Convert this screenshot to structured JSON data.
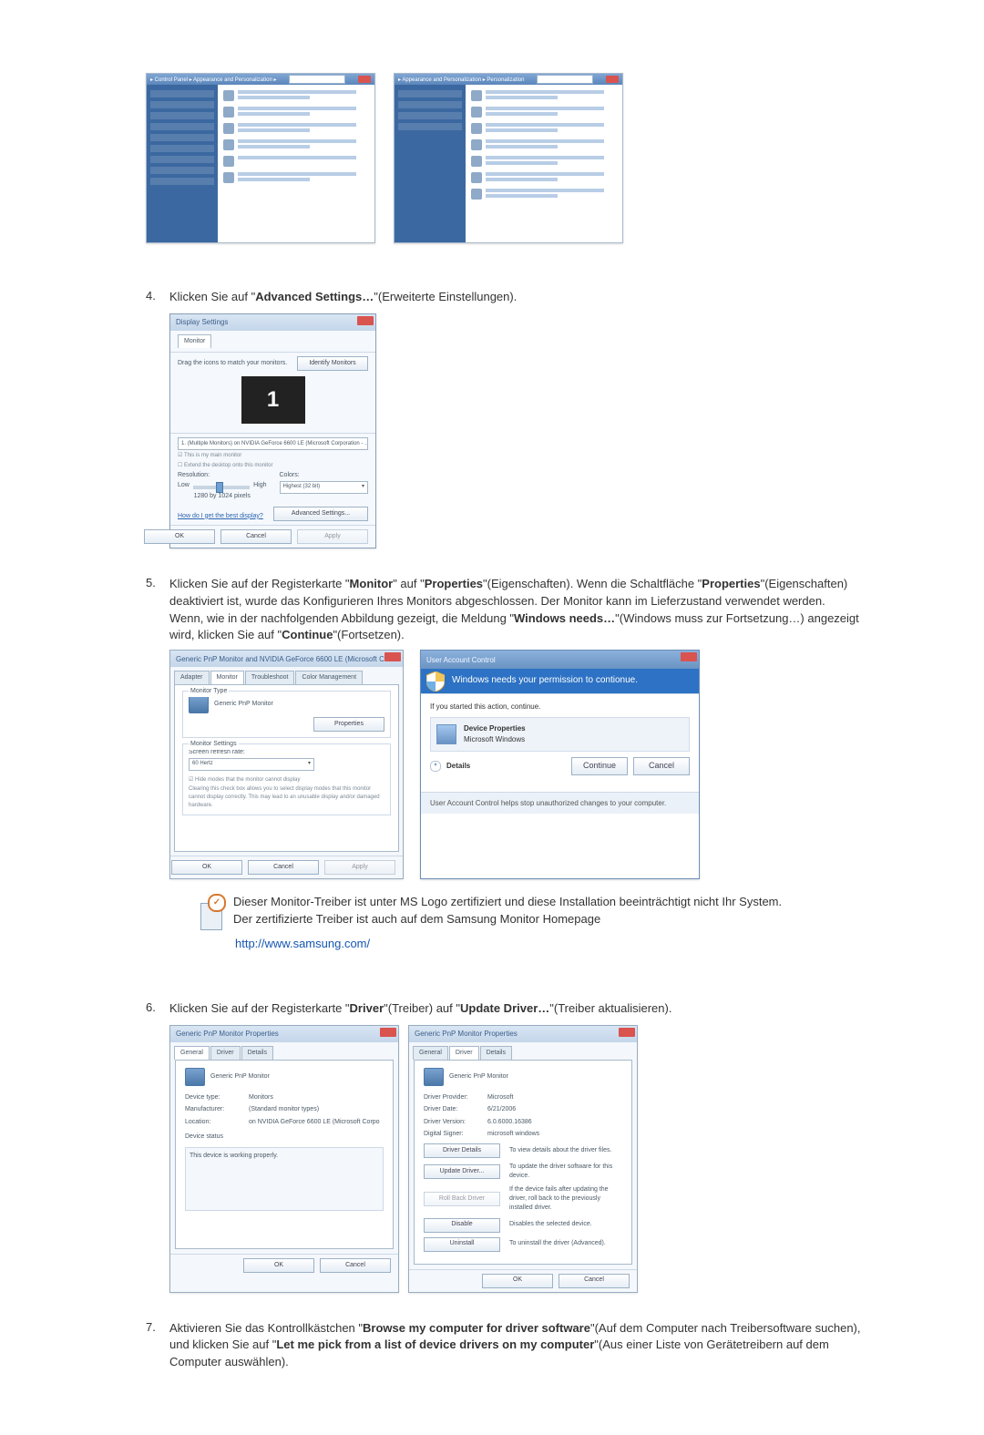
{
  "step4": {
    "num": "4.",
    "text1": "Klicken Sie auf \"",
    "bold1": "Advanced Settings…",
    "text2": "\"(Erweiterte Einstellungen).",
    "dlg": {
      "title": "Display Settings",
      "tab": "Monitor",
      "drag": "Drag the icons to match your monitors.",
      "identify": "Identify Monitors",
      "preview": "1",
      "monitorSelect": "1. (Multiple Monitors) on NVIDIA GeForce 6600 LE (Microsoft Corporation - …",
      "mainCheck": "☑ This is my main monitor",
      "extendCheck": "☐ Extend the desktop onto this monitor",
      "resLabel": "Resolution:",
      "resLow": "Low",
      "resHigh": "High",
      "resValue": "1280 by 1024 pixels",
      "colorsLabel": "Colors:",
      "colorsValue": "Highest (32 bit)",
      "helpLink": "How do I get the best display?",
      "advanced": "Advanced Settings...",
      "ok": "OK",
      "cancel": "Cancel",
      "apply": "Apply"
    }
  },
  "step5": {
    "num": "5.",
    "l1_a": "Klicken Sie auf der Registerkarte \"",
    "l1_b": "Monitor",
    "l1_c": "\" auf \"",
    "l1_d": "Properties",
    "l1_e": "\"(Eigenschaften). Wenn die Schaltfläche \"",
    "l1_f": "Properties",
    "l1_g": "\"(Eigenschaften) deaktiviert ist, wurde das Konfigurieren Ihres Monitors abgeschlossen. Der Monitor kann im Lieferzustand verwendet werden.",
    "l2_a": "Wenn, wie in der nachfolgenden Abbildung gezeigt, die Meldung \"",
    "l2_b": "Windows needs…",
    "l2_c": "\"(Windows muss zur Fortsetzung…) angezeigt wird, klicken Sie auf \"",
    "l2_d": "Continue",
    "l2_e": "\"(Fortsetzen).",
    "mon": {
      "title": "Generic PnP Monitor and NVIDIA GeForce 6600 LE (Microsoft Co...",
      "tabs": [
        "Adapter",
        "Monitor",
        "Troubleshoot",
        "Color Management"
      ],
      "typeLabel": "Monitor Type",
      "typeValue": "Generic PnP Monitor",
      "propsBtn": "Properties",
      "settingsLabel": "Monitor Settings",
      "refreshLabel": "Screen refresh rate:",
      "refreshValue": "60 Hertz",
      "hideCheck": "☑ Hide modes that the monitor cannot display",
      "hideHelp": "Clearing this check box allows you to select display modes that this monitor cannot display correctly. This may lead to an unusable display and/or damaged hardware.",
      "ok": "OK",
      "cancel": "Cancel",
      "apply": "Apply"
    },
    "uac": {
      "title": "User Account Control",
      "banner": "Windows needs your permission to contionue.",
      "started": "If you started this action, continue.",
      "itemTitle": "Device Properties",
      "itemPub": "Microsoft Windows",
      "details": "Details",
      "continue": "Continue",
      "cancel": "Cancel",
      "footer": "User Account Control helps stop unauthorized changes to your computer."
    }
  },
  "note": {
    "l1": "Dieser Monitor-Treiber ist unter MS Logo zertifiziert und diese Installation beeinträchtigt nicht Ihr System.",
    "l2": "Der zertifizierte Treiber ist auch auf dem Samsung Monitor Homepage",
    "link": "http://www.samsung.com/"
  },
  "step6": {
    "num": "6.",
    "a": "Klicken Sie auf der Registerkarte \"",
    "b": "Driver",
    "c": "\"(Treiber) auf \"",
    "d": "Update Driver…",
    "e": "\"(Treiber aktualisieren).",
    "left": {
      "title": "Generic PnP Monitor Properties",
      "tabs": [
        "General",
        "Driver",
        "Details"
      ],
      "device": "Generic PnP Monitor",
      "devType": {
        "k": "Device type:",
        "v": "Monitors"
      },
      "manu": {
        "k": "Manufacturer:",
        "v": "(Standard monitor types)"
      },
      "loc": {
        "k": "Location:",
        "v": "on NVIDIA GeForce 6600 LE (Microsoft Corpo"
      },
      "statusLabel": "Device status",
      "status": "This device is working properly.",
      "ok": "OK",
      "cancel": "Cancel"
    },
    "right": {
      "title": "Generic PnP Monitor Properties",
      "tabs": [
        "General",
        "Driver",
        "Details"
      ],
      "device": "Generic PnP Monitor",
      "provider": {
        "k": "Driver Provider:",
        "v": "Microsoft"
      },
      "date": {
        "k": "Driver Date:",
        "v": "6/21/2006"
      },
      "version": {
        "k": "Driver Version:",
        "v": "6.0.6000.16386"
      },
      "signer": {
        "k": "Digital Signer:",
        "v": "microsoft windows"
      },
      "btnDetails": "Driver Details",
      "btnDetailsDesc": "To view details about the driver files.",
      "btnUpdate": "Update Driver...",
      "btnUpdateDesc": "To update the driver software for this device.",
      "btnRoll": "Roll Back Driver",
      "btnRollDesc": "If the device fails after updating the driver, roll back to the previously installed driver.",
      "btnDisable": "Disable",
      "btnDisableDesc": "Disables the selected device.",
      "btnUninstall": "Uninstall",
      "btnUninstallDesc": "To uninstall the driver (Advanced).",
      "ok": "OK",
      "cancel": "Cancel"
    }
  },
  "step7": {
    "num": "7.",
    "a": "Aktivieren Sie das Kontrollkästchen \"",
    "b": "Browse my computer for driver software",
    "c": "\"(Auf dem Computer nach Treibersoftware suchen), und klicken Sie auf \"",
    "d": "Let me pick from a list of device drivers on my computer",
    "e": "\"(Aus einer Liste von Gerätetreibern auf dem Computer auswählen)."
  }
}
